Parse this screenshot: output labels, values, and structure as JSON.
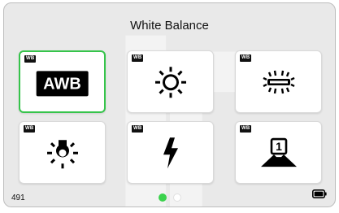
{
  "screen": {
    "title": "White Balance",
    "shot_count": "491"
  },
  "tiles": [
    {
      "badge": "WB",
      "icon": "awb-icon",
      "label": "AWB",
      "selected": true
    },
    {
      "badge": "WB",
      "icon": "daylight-sun-icon",
      "selected": false
    },
    {
      "badge": "WB",
      "icon": "fluorescent-icon",
      "selected": false
    },
    {
      "badge": "WB",
      "icon": "tungsten-bulb-icon",
      "selected": false
    },
    {
      "badge": "WB",
      "icon": "flash-icon",
      "selected": false
    },
    {
      "badge": "WB",
      "icon": "custom-wb-1-icon",
      "label": "1",
      "selected": false
    }
  ],
  "pagination": {
    "pages": 2,
    "current": 1
  },
  "status": {
    "battery_icon": "battery-icon"
  },
  "colors": {
    "accent": "#36c44b",
    "active_dot": "#3ad24c",
    "background": "#e9e9e9"
  }
}
